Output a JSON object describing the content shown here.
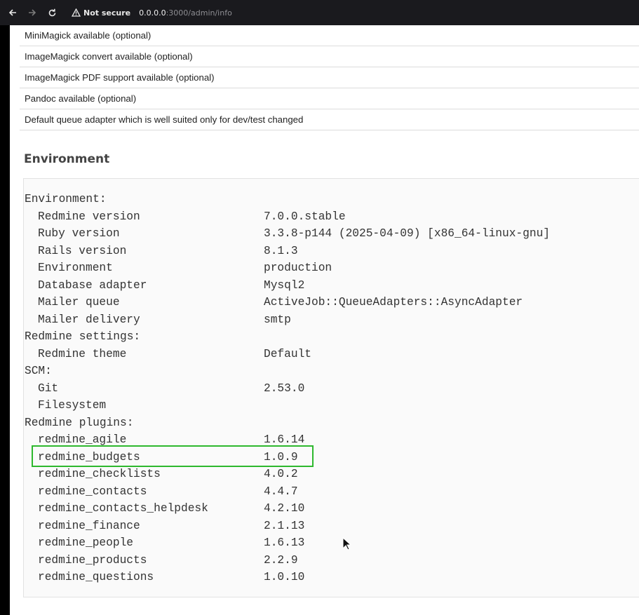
{
  "browser": {
    "security_label": "Not secure",
    "url_host": "0.0.0.0",
    "url_path": ":3000/admin/info"
  },
  "checks": [
    "MiniMagick available (optional)",
    "ImageMagick convert available (optional)",
    "ImageMagick PDF support available (optional)",
    "Pandoc available (optional)",
    "Default queue adapter which is well suited only for dev/test changed"
  ],
  "environment": {
    "heading": "Environment",
    "lines": [
      {
        "key": "Environment:",
        "value": "",
        "indent": 0
      },
      {
        "key": "Redmine version",
        "value": "7.0.0.stable",
        "indent": 1
      },
      {
        "key": "Ruby version",
        "value": "3.3.8-p144 (2025-04-09) [x86_64-linux-gnu]",
        "indent": 1
      },
      {
        "key": "Rails version",
        "value": "8.1.3",
        "indent": 1
      },
      {
        "key": "Environment",
        "value": "production",
        "indent": 1
      },
      {
        "key": "Database adapter",
        "value": "Mysql2",
        "indent": 1
      },
      {
        "key": "Mailer queue",
        "value": "ActiveJob::QueueAdapters::AsyncAdapter",
        "indent": 1
      },
      {
        "key": "Mailer delivery",
        "value": "smtp",
        "indent": 1
      },
      {
        "key": "Redmine settings:",
        "value": "",
        "indent": 0
      },
      {
        "key": "Redmine theme",
        "value": "Default",
        "indent": 1
      },
      {
        "key": "SCM:",
        "value": "",
        "indent": 0
      },
      {
        "key": "Git",
        "value": "2.53.0",
        "indent": 1
      },
      {
        "key": "Filesystem",
        "value": "",
        "indent": 1
      },
      {
        "key": "Redmine plugins:",
        "value": "",
        "indent": 0
      },
      {
        "key": "redmine_agile",
        "value": "1.6.14",
        "indent": 1
      },
      {
        "key": "redmine_budgets",
        "value": "1.0.9",
        "indent": 1
      },
      {
        "key": "redmine_checklists",
        "value": "4.0.2",
        "indent": 1
      },
      {
        "key": "redmine_contacts",
        "value": "4.4.7",
        "indent": 1
      },
      {
        "key": "redmine_contacts_helpdesk",
        "value": "4.2.10",
        "indent": 1
      },
      {
        "key": "redmine_finance",
        "value": "2.1.13",
        "indent": 1
      },
      {
        "key": "redmine_people",
        "value": "1.6.13",
        "indent": 1
      },
      {
        "key": "redmine_products",
        "value": "2.2.9",
        "indent": 1
      },
      {
        "key": "redmine_questions",
        "value": "1.0.10",
        "indent": 1
      }
    ]
  },
  "colors": {
    "highlight": "#2eb82e",
    "topbar": "#1a1a1e"
  },
  "icons": [
    "back-arrow-icon",
    "forward-arrow-icon",
    "reload-icon",
    "warning-triangle-icon",
    "mouse-pointer-icon"
  ]
}
